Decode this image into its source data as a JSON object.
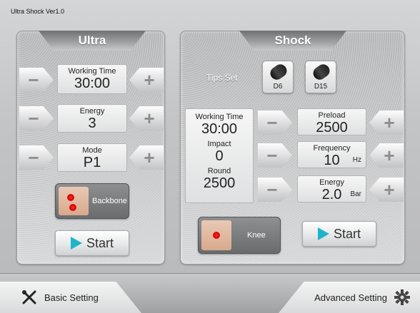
{
  "app": {
    "title": "Ultra  Shock  Ver1.0"
  },
  "ultra": {
    "title": "Ultra",
    "working_time": {
      "label": "Working Time",
      "value": "30:00"
    },
    "energy": {
      "label": "Energy",
      "value": "3"
    },
    "mode": {
      "label": "Mode",
      "value": "P1"
    },
    "area_button": {
      "label": "Backbone"
    },
    "start_label": "Start",
    "minus_symbol": "−",
    "plus_symbol": "+"
  },
  "shock": {
    "title": "Shock",
    "tips_label": "Tips Set",
    "tips": [
      {
        "label": "D6"
      },
      {
        "label": "D15"
      }
    ],
    "status": {
      "working_time_label": "Working Time",
      "working_time_value": "30:00",
      "impact_label": "Impact",
      "impact_value": "0",
      "round_label": "Round",
      "round_value": "2500"
    },
    "preload": {
      "label": "Preload",
      "value": "2500"
    },
    "frequency": {
      "label": "Frequency",
      "value": "10",
      "unit": "Hz"
    },
    "energy": {
      "label": "Energy",
      "value": "2.0",
      "unit": "Bar"
    },
    "area_button": {
      "label": "Knee"
    },
    "start_label": "Start",
    "minus_symbol": "−",
    "plus_symbol": "+"
  },
  "footer": {
    "basic_setting": "Basic Setting",
    "advanced_setting": "Advanced Setting",
    "icons": {
      "left": "tools-icon",
      "right": "gear-icon"
    }
  },
  "colors": {
    "accent": "#1fb4c8",
    "panel_tab": "#8a8b8d"
  }
}
